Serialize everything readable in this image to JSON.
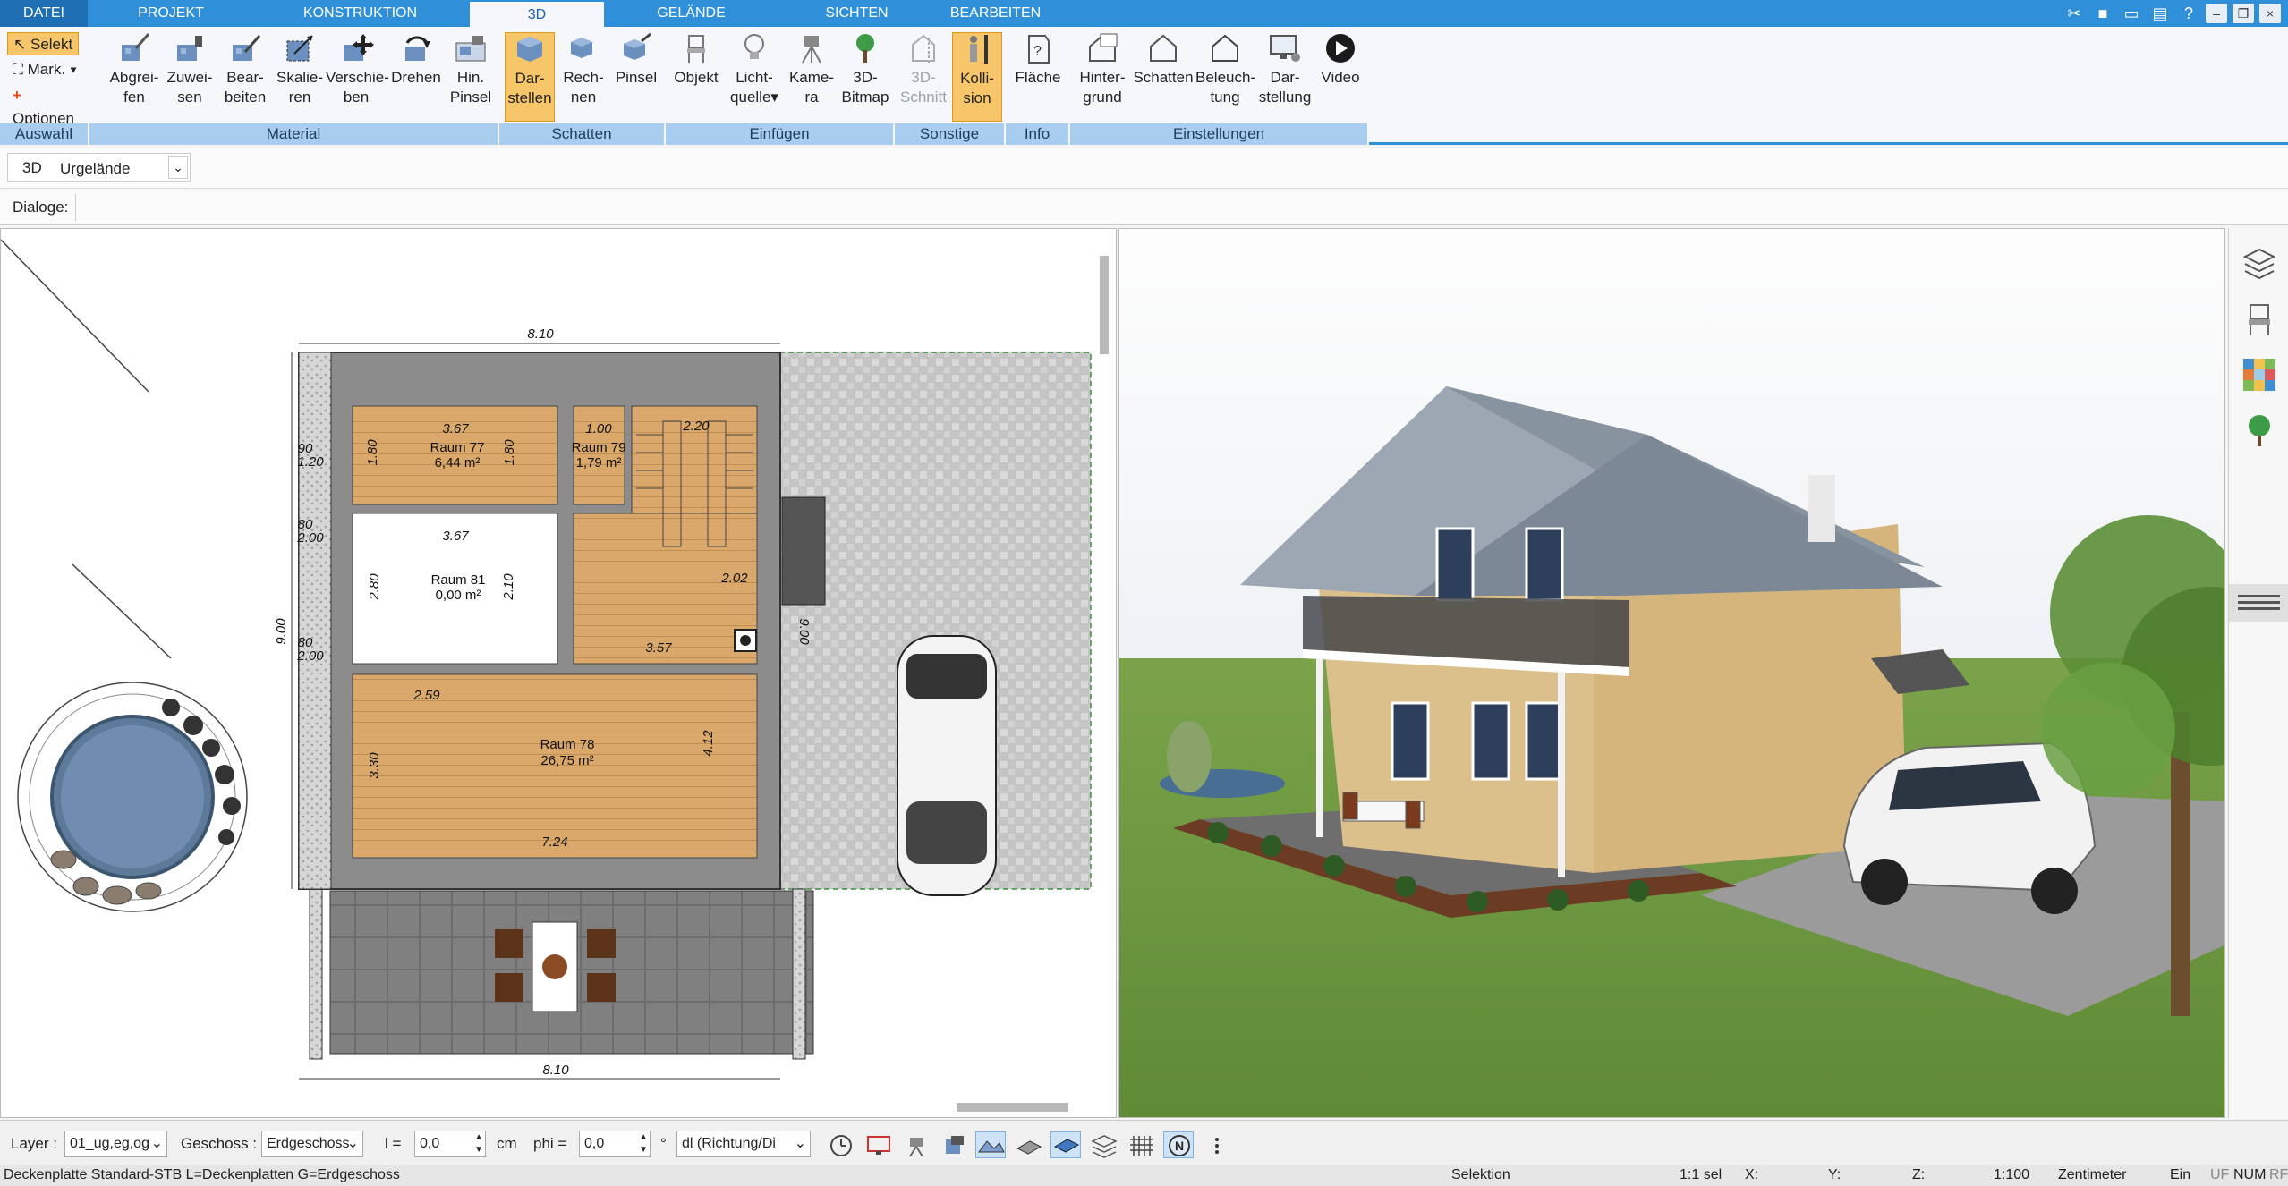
{
  "tabs": [
    {
      "label": "DATEI"
    },
    {
      "label": "PROJEKT"
    },
    {
      "label": "KONSTRUKTION"
    },
    {
      "label": "3D"
    },
    {
      "label": "GELÄNDE"
    },
    {
      "label": "SICHTEN"
    },
    {
      "label": "BEARBEITEN"
    }
  ],
  "auswahl": {
    "selekt": "Selekt",
    "mark": "Mark.",
    "optionen": "Optionen",
    "label": "Auswahl"
  },
  "material": {
    "label": "Material",
    "buttons": [
      {
        "l1": "Abgrei-",
        "l2": "fen"
      },
      {
        "l1": "Zuwei-",
        "l2": "sen"
      },
      {
        "l1": "Bear-",
        "l2": "beiten"
      },
      {
        "l1": "Skalie-",
        "l2": "ren"
      },
      {
        "l1": "Verschie-",
        "l2": "ben"
      },
      {
        "l1": "Drehen",
        "l2": ""
      },
      {
        "l1": "Hin.",
        "l2": "Pinsel"
      }
    ]
  },
  "schatten": {
    "label": "Schatten",
    "buttons": [
      {
        "l1": "Dar-",
        "l2": "stellen"
      },
      {
        "l1": "Rech-",
        "l2": "nen"
      },
      {
        "l1": "Pinsel",
        "l2": ""
      }
    ]
  },
  "einfuegen": {
    "label": "Einfügen",
    "buttons": [
      {
        "l1": "Objekt",
        "l2": ""
      },
      {
        "l1": "Licht-",
        "l2": "quelle"
      },
      {
        "l1": "Kame-",
        "l2": "ra"
      },
      {
        "l1": "3D-",
        "l2": "Bitmap"
      }
    ]
  },
  "sonstige": {
    "label": "Sonstige",
    "buttons": [
      {
        "l1": "3D-",
        "l2": "Schnitt"
      },
      {
        "l1": "Kolli-",
        "l2": "sion"
      }
    ]
  },
  "info": {
    "label": "Info",
    "buttons": [
      {
        "l1": "Fläche",
        "l2": ""
      }
    ]
  },
  "einstellungen": {
    "label": "Einstellungen",
    "buttons": [
      {
        "l1": "Hinter-",
        "l2": "grund"
      },
      {
        "l1": "Schatten",
        "l2": ""
      },
      {
        "l1": "Beleuch-",
        "l2": "tung"
      },
      {
        "l1": "Dar-",
        "l2": "stellung"
      },
      {
        "l1": "Video",
        "l2": ""
      }
    ]
  },
  "row3d": {
    "prefix": "3D",
    "select_value": "Urgelände"
  },
  "dialoge": {
    "label": "Dialoge:"
  },
  "plan": {
    "dims": {
      "top": "8.10",
      "bottom": "8.10",
      "left": "9.00",
      "right": "9.00",
      "d367a": "3.67",
      "d367b": "3.67",
      "d100": "1.00",
      "d220": "2.20",
      "d180a": "1.80",
      "d180b": "1.80",
      "d210": "2.10",
      "d280": "2.80",
      "d357": "3.57",
      "d259": "2.59",
      "d412": "4.12",
      "d330": "3.30",
      "d724": "7.24",
      "d200a": "2.00",
      "d200b": "2.00",
      "d202": "2.02",
      "d90": "90",
      "d120": "1.20",
      "d80a": "80",
      "d80b": "80"
    },
    "rooms": [
      {
        "name": "Raum 77",
        "area": "6,44 m²"
      },
      {
        "name": "Raum 79",
        "area": "1,79 m²"
      },
      {
        "name": "Raum 81",
        "area": "0,00 m²"
      },
      {
        "name": "Raum 78",
        "area": "26,75 m²"
      }
    ]
  },
  "bottom": {
    "layer_label": "Layer :",
    "layer_value": "01_ug,eg,og",
    "geschoss_label": "Geschoss :",
    "geschoss_value": "Erdgeschoss",
    "l_label": "l =",
    "l_value": "0,0",
    "l_unit": "cm",
    "phi_label": "phi =",
    "phi_value": "0,0",
    "phi_unit": "°",
    "dl_value": "dl (Richtung/Di"
  },
  "status": {
    "left": "Deckenplatte Standard-STB L=Deckenplatten G=Erdgeschoss",
    "mode": "Selektion",
    "sel": "1:1 sel",
    "x": "X:",
    "y": "Y:",
    "z": "Z:",
    "scale": "1:100",
    "unit": "Zentimeter",
    "ein": "Ein",
    "uf": "UF",
    "num": "NUM",
    "rf": "RF"
  },
  "colors": {
    "accent": "#2f8fd8",
    "group_label": "#a8cdef",
    "selected": "#f7c66b",
    "floor": "#d9a86a",
    "wall": "#8c8c8c"
  }
}
